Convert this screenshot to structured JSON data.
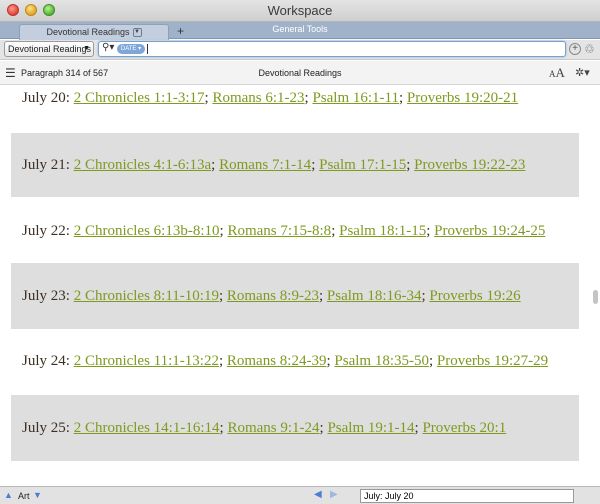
{
  "window": {
    "title": "Workspace"
  },
  "tabbar": {
    "label": "General Tools",
    "tab_label": "Devotional Readings",
    "add_label": "+"
  },
  "search": {
    "resource": "Devotional Readings",
    "token": "DATE",
    "query": ""
  },
  "info": {
    "paragraph": "Paragraph 314 of 567",
    "title": "Devotional Readings",
    "font_small": "A",
    "font_big": "A"
  },
  "readings": [
    {
      "date": "July 20: ",
      "refs": [
        "2 Chronicles 1:1-3:17",
        "Romans 6:1-23",
        "Psalm 16:1-11",
        "Proverbs 19:20-21"
      ],
      "shaded": false
    },
    {
      "date": "July 21: ",
      "refs": [
        "2 Chronicles 4:1-6:13a",
        "Romans 7:1-14",
        "Psalm 17:1-15",
        "Proverbs 19:22-23"
      ],
      "shaded": true
    },
    {
      "date": "July 22: ",
      "refs": [
        "2 Chronicles 6:13b-8:10",
        "Romans 7:15-8:8",
        "Psalm 18:1-15",
        "Proverbs 19:24-25"
      ],
      "shaded": false
    },
    {
      "date": "July 23: ",
      "refs": [
        "2 Chronicles 8:11-10:19",
        "Romans 8:9-23",
        "Psalm 18:16-34",
        "Proverbs 19:26"
      ],
      "shaded": true
    },
    {
      "date": "July 24: ",
      "refs": [
        "2 Chronicles 11:1-13:22",
        "Romans 8:24-39",
        "Psalm 18:35-50",
        "Proverbs 19:27-29"
      ],
      "shaded": false
    },
    {
      "date": "July 25: ",
      "refs": [
        "2 Chronicles 14:1-16:14",
        "Romans 9:1-24",
        "Psalm 19:1-14",
        "Proverbs 20:1"
      ],
      "shaded": true
    }
  ],
  "separator": "; ",
  "bottom": {
    "label": "Art",
    "goto_value": "July: July 20"
  },
  "colors": {
    "link": "#7e9a20",
    "date_text": "#3c3024",
    "shade": "#dedede",
    "tabbar": "#9fb2c9"
  },
  "icons": [
    "close-icon",
    "minimize-icon",
    "zoom-icon",
    "search-icon",
    "add-icon",
    "share-icon",
    "list-icon",
    "gear-icon",
    "arrow-up-icon",
    "arrow-down-icon",
    "back-icon",
    "forward-icon"
  ]
}
